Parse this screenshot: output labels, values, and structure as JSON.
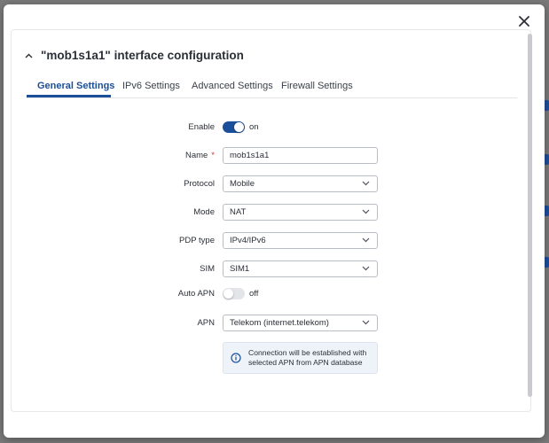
{
  "modal": {
    "title": "\"mob1s1a1\" interface configuration",
    "close_icon": "close-icon"
  },
  "tabs": [
    {
      "label": "General Settings",
      "active": true
    },
    {
      "label": "IPv6 Settings",
      "active": false
    },
    {
      "label": "Advanced Settings",
      "active": false
    },
    {
      "label": "Firewall Settings",
      "active": false
    }
  ],
  "form": {
    "enable": {
      "label": "Enable",
      "state": true,
      "state_text": "on"
    },
    "name": {
      "label": "Name",
      "required_mark": "*",
      "value": "mob1s1a1"
    },
    "protocol": {
      "label": "Protocol",
      "value": "Mobile"
    },
    "mode": {
      "label": "Mode",
      "value": "NAT"
    },
    "pdp_type": {
      "label": "PDP type",
      "value": "IPv4/IPv6"
    },
    "sim": {
      "label": "SIM",
      "value": "SIM1"
    },
    "auto_apn": {
      "label": "Auto APN",
      "state": false,
      "state_text": "off"
    },
    "apn": {
      "label": "APN",
      "value": "Telekom (internet.telekom)"
    }
  },
  "info_box": {
    "text_line1": "Connection will be established with",
    "text_line2": "selected APN from APN database",
    "icon": "info-icon"
  },
  "colors": {
    "accent": "#1b4f99",
    "required": "#d43a3a",
    "backdrop": "#7a7a7a"
  }
}
